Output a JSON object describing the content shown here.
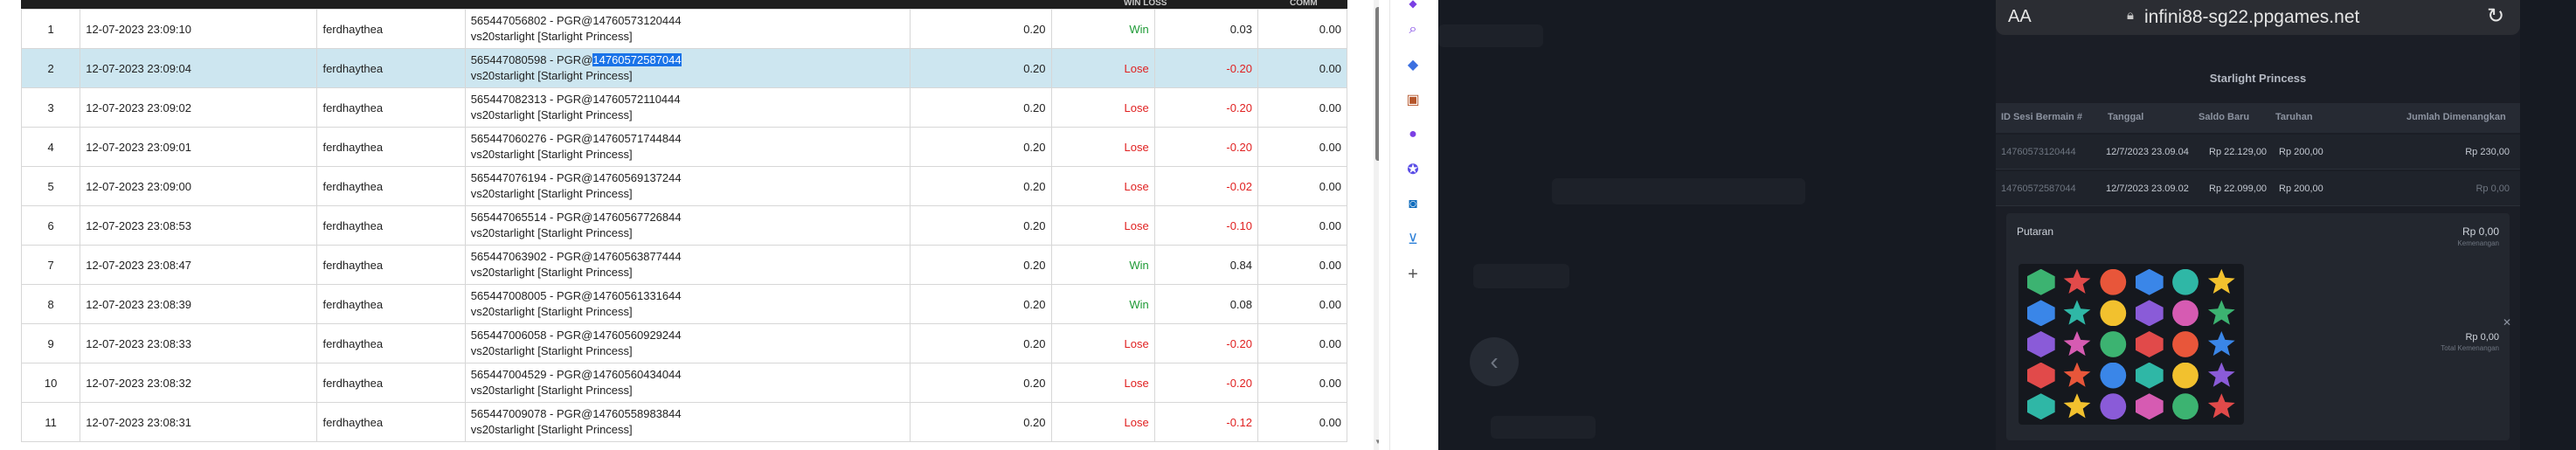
{
  "header": {
    "col_win_loss": "WIN LOSS",
    "col_comm": "COMM"
  },
  "table": {
    "rows": [
      {
        "no": "1",
        "date": "12-07-2023 23:09:10",
        "user": "ferdhaythea",
        "ref_pre": "565447056802 - PGR@14760573120444",
        "ref_hl": "",
        "ref_post": "",
        "game": "vs20starlight [Starlight Princess]",
        "bet": "0.20",
        "result": "Win",
        "win_loss": "0.03",
        "comm": "0.00"
      },
      {
        "no": "2",
        "date": "12-07-2023 23:09:04",
        "user": "ferdhaythea",
        "ref_pre": "565447080598 - PGR@",
        "ref_hl": "14760572587044",
        "ref_post": "",
        "game": "vs20starlight [Starlight Princess]",
        "bet": "0.20",
        "result": "Lose",
        "win_loss": "-0.20",
        "comm": "0.00"
      },
      {
        "no": "3",
        "date": "12-07-2023 23:09:02",
        "user": "ferdhaythea",
        "ref_pre": "565447082313 - PGR@14760572110444",
        "ref_hl": "",
        "ref_post": "",
        "game": "vs20starlight [Starlight Princess]",
        "bet": "0.20",
        "result": "Lose",
        "win_loss": "-0.20",
        "comm": "0.00"
      },
      {
        "no": "4",
        "date": "12-07-2023 23:09:01",
        "user": "ferdhaythea",
        "ref_pre": "565447060276 - PGR@14760571744844",
        "ref_hl": "",
        "ref_post": "",
        "game": "vs20starlight [Starlight Princess]",
        "bet": "0.20",
        "result": "Lose",
        "win_loss": "-0.20",
        "comm": "0.00"
      },
      {
        "no": "5",
        "date": "12-07-2023 23:09:00",
        "user": "ferdhaythea",
        "ref_pre": "565447076194 - PGR@14760569137244",
        "ref_hl": "",
        "ref_post": "",
        "game": "vs20starlight [Starlight Princess]",
        "bet": "0.20",
        "result": "Lose",
        "win_loss": "-0.02",
        "comm": "0.00"
      },
      {
        "no": "6",
        "date": "12-07-2023 23:08:53",
        "user": "ferdhaythea",
        "ref_pre": "565447065514 - PGR@14760567726844",
        "ref_hl": "",
        "ref_post": "",
        "game": "vs20starlight [Starlight Princess]",
        "bet": "0.20",
        "result": "Lose",
        "win_loss": "-0.10",
        "comm": "0.00"
      },
      {
        "no": "7",
        "date": "12-07-2023 23:08:47",
        "user": "ferdhaythea",
        "ref_pre": "565447063902 - PGR@14760563877444",
        "ref_hl": "",
        "ref_post": "",
        "game": "vs20starlight [Starlight Princess]",
        "bet": "0.20",
        "result": "Win",
        "win_loss": "0.84",
        "comm": "0.00"
      },
      {
        "no": "8",
        "date": "12-07-2023 23:08:39",
        "user": "ferdhaythea",
        "ref_pre": "565447008005 - PGR@14760561331644",
        "ref_hl": "",
        "ref_post": "",
        "game": "vs20starlight [Starlight Princess]",
        "bet": "0.20",
        "result": "Win",
        "win_loss": "0.08",
        "comm": "0.00"
      },
      {
        "no": "9",
        "date": "12-07-2023 23:08:33",
        "user": "ferdhaythea",
        "ref_pre": "565447006058 - PGR@14760560929244",
        "ref_hl": "",
        "ref_post": "",
        "game": "vs20starlight [Starlight Princess]",
        "bet": "0.20",
        "result": "Lose",
        "win_loss": "-0.20",
        "comm": "0.00"
      },
      {
        "no": "10",
        "date": "12-07-2023 23:08:32",
        "user": "ferdhaythea",
        "ref_pre": "565447004529 - PGR@14760560434044",
        "ref_hl": "",
        "ref_post": "",
        "game": "vs20starlight [Starlight Princess]",
        "bet": "0.20",
        "result": "Lose",
        "win_loss": "-0.20",
        "comm": "0.00"
      },
      {
        "no": "11",
        "date": "12-07-2023 23:08:31",
        "user": "ferdhaythea",
        "ref_pre": "565447009078 - PGR@14760558983844",
        "ref_hl": "",
        "ref_post": "",
        "game": "vs20starlight [Starlight Princess]",
        "bet": "0.20",
        "result": "Lose",
        "win_loss": "-0.12",
        "comm": "0.00"
      }
    ]
  },
  "sidebar": {
    "add_label": "+"
  },
  "phone": {
    "aa_label": "AA",
    "url": "infini88-sg22.ppgames.net",
    "game_title": "Starlight Princess",
    "history_columns": [
      "ID Sesi Bermain #",
      "Tanggal",
      "Saldo Baru",
      "Taruhan",
      "Jumlah Dimenangkan"
    ],
    "history_rows": [
      {
        "id": "14760573120444",
        "date": "12/7/2023 23.09.04",
        "balance": "Rp 22.129,00",
        "bet": "Rp 200,00",
        "win": "Rp 230,00"
      },
      {
        "id": "14760572587044",
        "date": "12/7/2023 23.09.02",
        "balance": "Rp 22.099,00",
        "bet": "Rp 200,00",
        "win": "Rp 0,00"
      }
    ],
    "spin": {
      "label": "Putaran",
      "top_value": "Rp 0,00",
      "top_sub": "Kemenangan",
      "mid_value": "Rp 0,00",
      "mid_sub": "Total Kemenangan"
    },
    "symbol_colors": [
      "#3cb371",
      "#f2c12e",
      "#e8563a",
      "#d65bb2",
      "#2fb7a6",
      "#e14a4a",
      "#8a5bd8",
      "#3a86e8"
    ]
  }
}
